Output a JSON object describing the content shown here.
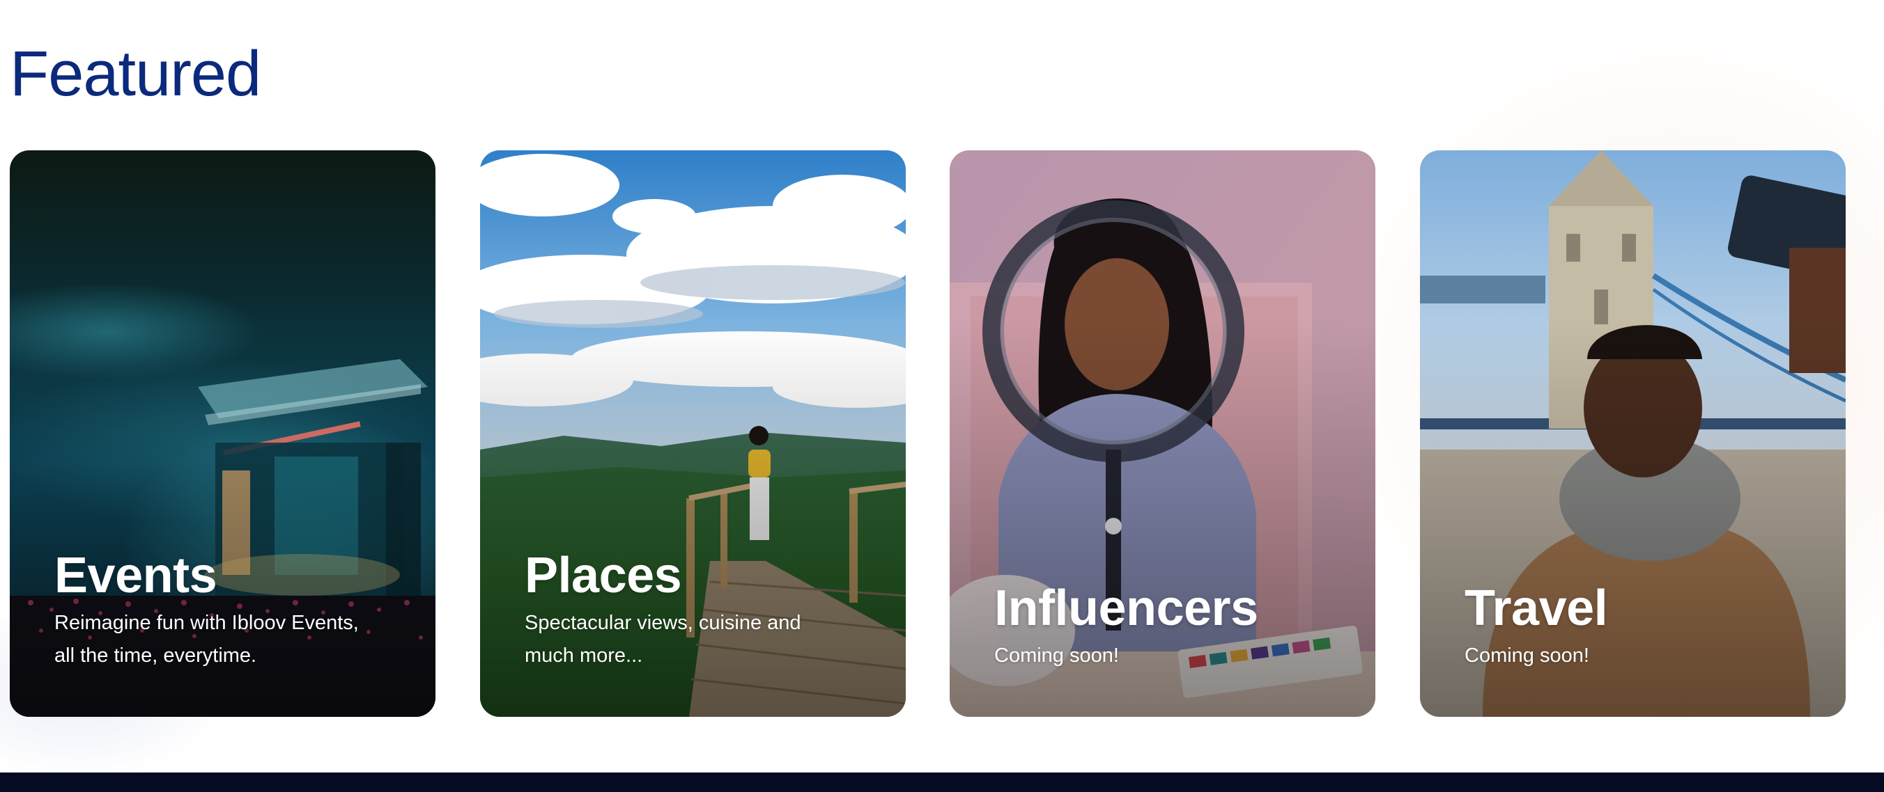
{
  "section": {
    "title": "Featured"
  },
  "cards": [
    {
      "title": "Events",
      "description": "Reimagine fun with Ibloov Events, all the time, everytime.",
      "image": "concert-stage-image"
    },
    {
      "title": "Places",
      "description": "Spectacular views, cuisine and much more...",
      "image": "mountain-viewpoint-image"
    },
    {
      "title": "Influencers",
      "description": "Coming soon!",
      "image": "ring-light-creator-image"
    },
    {
      "title": "Travel",
      "description": "Coming soon!",
      "image": "tower-bridge-selfie-image"
    }
  ],
  "colors": {
    "title": "#0b2a7d",
    "card_text": "#ffffff",
    "footer": "#050b22"
  }
}
